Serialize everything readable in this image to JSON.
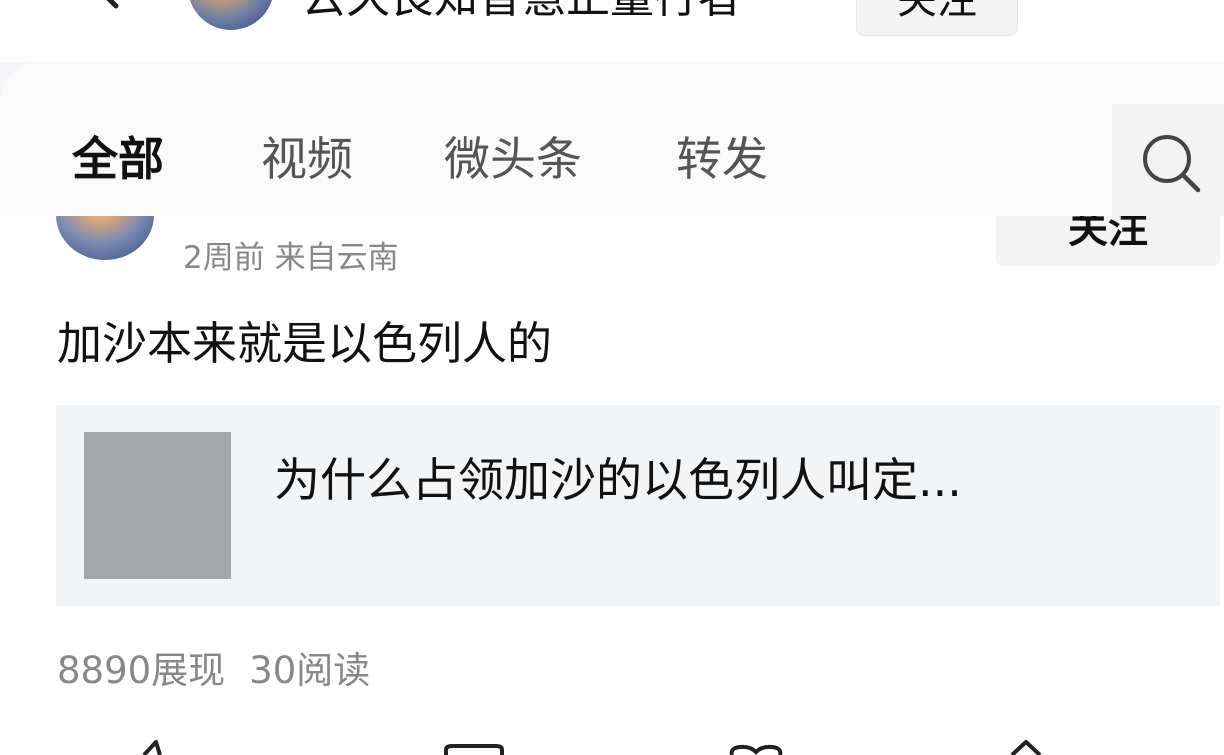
{
  "header": {
    "author_name": "云久良知智慧正量行者",
    "follow_label": "关注"
  },
  "tabs": [
    {
      "label": "全部",
      "active": true
    },
    {
      "label": "视频",
      "active": false
    },
    {
      "label": "微头条",
      "active": false
    },
    {
      "label": "转发",
      "active": false
    }
  ],
  "post": {
    "meta": "2周前 来自云南",
    "follow_label": "关注",
    "text": "加沙本来就是以色列人的",
    "link_card": {
      "title": "为什么占领加沙的以色列人叫定..."
    },
    "stats": {
      "impressions": "8890展现",
      "reads": "30阅读"
    }
  },
  "icons": {
    "back": "chevron-left-icon",
    "search": "search-icon",
    "bottom": [
      "share-icon",
      "comment-icon",
      "like-icon",
      "forward-icon"
    ]
  },
  "colors": {
    "tab_bar_bg": "#fafafa",
    "meta_text": "#888888",
    "card_bg": "#f3f4f6",
    "thumb_placeholder": "#a5a6a9"
  }
}
